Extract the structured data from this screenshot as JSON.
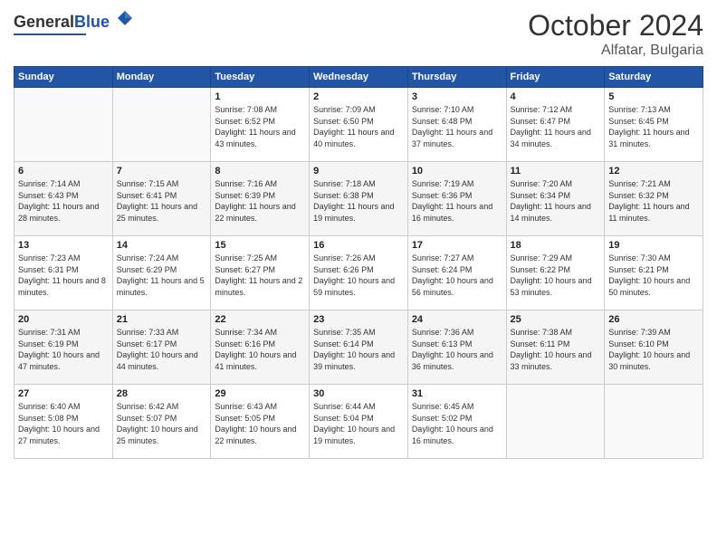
{
  "header": {
    "logo_general": "General",
    "logo_blue": "Blue",
    "month": "October 2024",
    "location": "Alfatar, Bulgaria"
  },
  "weekdays": [
    "Sunday",
    "Monday",
    "Tuesday",
    "Wednesday",
    "Thursday",
    "Friday",
    "Saturday"
  ],
  "weeks": [
    [
      {
        "num": "",
        "info": ""
      },
      {
        "num": "",
        "info": ""
      },
      {
        "num": "1",
        "info": "Sunrise: 7:08 AM\nSunset: 6:52 PM\nDaylight: 11 hours and 43 minutes."
      },
      {
        "num": "2",
        "info": "Sunrise: 7:09 AM\nSunset: 6:50 PM\nDaylight: 11 hours and 40 minutes."
      },
      {
        "num": "3",
        "info": "Sunrise: 7:10 AM\nSunset: 6:48 PM\nDaylight: 11 hours and 37 minutes."
      },
      {
        "num": "4",
        "info": "Sunrise: 7:12 AM\nSunset: 6:47 PM\nDaylight: 11 hours and 34 minutes."
      },
      {
        "num": "5",
        "info": "Sunrise: 7:13 AM\nSunset: 6:45 PM\nDaylight: 11 hours and 31 minutes."
      }
    ],
    [
      {
        "num": "6",
        "info": "Sunrise: 7:14 AM\nSunset: 6:43 PM\nDaylight: 11 hours and 28 minutes."
      },
      {
        "num": "7",
        "info": "Sunrise: 7:15 AM\nSunset: 6:41 PM\nDaylight: 11 hours and 25 minutes."
      },
      {
        "num": "8",
        "info": "Sunrise: 7:16 AM\nSunset: 6:39 PM\nDaylight: 11 hours and 22 minutes."
      },
      {
        "num": "9",
        "info": "Sunrise: 7:18 AM\nSunset: 6:38 PM\nDaylight: 11 hours and 19 minutes."
      },
      {
        "num": "10",
        "info": "Sunrise: 7:19 AM\nSunset: 6:36 PM\nDaylight: 11 hours and 16 minutes."
      },
      {
        "num": "11",
        "info": "Sunrise: 7:20 AM\nSunset: 6:34 PM\nDaylight: 11 hours and 14 minutes."
      },
      {
        "num": "12",
        "info": "Sunrise: 7:21 AM\nSunset: 6:32 PM\nDaylight: 11 hours and 11 minutes."
      }
    ],
    [
      {
        "num": "13",
        "info": "Sunrise: 7:23 AM\nSunset: 6:31 PM\nDaylight: 11 hours and 8 minutes."
      },
      {
        "num": "14",
        "info": "Sunrise: 7:24 AM\nSunset: 6:29 PM\nDaylight: 11 hours and 5 minutes."
      },
      {
        "num": "15",
        "info": "Sunrise: 7:25 AM\nSunset: 6:27 PM\nDaylight: 11 hours and 2 minutes."
      },
      {
        "num": "16",
        "info": "Sunrise: 7:26 AM\nSunset: 6:26 PM\nDaylight: 10 hours and 59 minutes."
      },
      {
        "num": "17",
        "info": "Sunrise: 7:27 AM\nSunset: 6:24 PM\nDaylight: 10 hours and 56 minutes."
      },
      {
        "num": "18",
        "info": "Sunrise: 7:29 AM\nSunset: 6:22 PM\nDaylight: 10 hours and 53 minutes."
      },
      {
        "num": "19",
        "info": "Sunrise: 7:30 AM\nSunset: 6:21 PM\nDaylight: 10 hours and 50 minutes."
      }
    ],
    [
      {
        "num": "20",
        "info": "Sunrise: 7:31 AM\nSunset: 6:19 PM\nDaylight: 10 hours and 47 minutes."
      },
      {
        "num": "21",
        "info": "Sunrise: 7:33 AM\nSunset: 6:17 PM\nDaylight: 10 hours and 44 minutes."
      },
      {
        "num": "22",
        "info": "Sunrise: 7:34 AM\nSunset: 6:16 PM\nDaylight: 10 hours and 41 minutes."
      },
      {
        "num": "23",
        "info": "Sunrise: 7:35 AM\nSunset: 6:14 PM\nDaylight: 10 hours and 39 minutes."
      },
      {
        "num": "24",
        "info": "Sunrise: 7:36 AM\nSunset: 6:13 PM\nDaylight: 10 hours and 36 minutes."
      },
      {
        "num": "25",
        "info": "Sunrise: 7:38 AM\nSunset: 6:11 PM\nDaylight: 10 hours and 33 minutes."
      },
      {
        "num": "26",
        "info": "Sunrise: 7:39 AM\nSunset: 6:10 PM\nDaylight: 10 hours and 30 minutes."
      }
    ],
    [
      {
        "num": "27",
        "info": "Sunrise: 6:40 AM\nSunset: 5:08 PM\nDaylight: 10 hours and 27 minutes."
      },
      {
        "num": "28",
        "info": "Sunrise: 6:42 AM\nSunset: 5:07 PM\nDaylight: 10 hours and 25 minutes."
      },
      {
        "num": "29",
        "info": "Sunrise: 6:43 AM\nSunset: 5:05 PM\nDaylight: 10 hours and 22 minutes."
      },
      {
        "num": "30",
        "info": "Sunrise: 6:44 AM\nSunset: 5:04 PM\nDaylight: 10 hours and 19 minutes."
      },
      {
        "num": "31",
        "info": "Sunrise: 6:45 AM\nSunset: 5:02 PM\nDaylight: 10 hours and 16 minutes."
      },
      {
        "num": "",
        "info": ""
      },
      {
        "num": "",
        "info": ""
      }
    ]
  ]
}
